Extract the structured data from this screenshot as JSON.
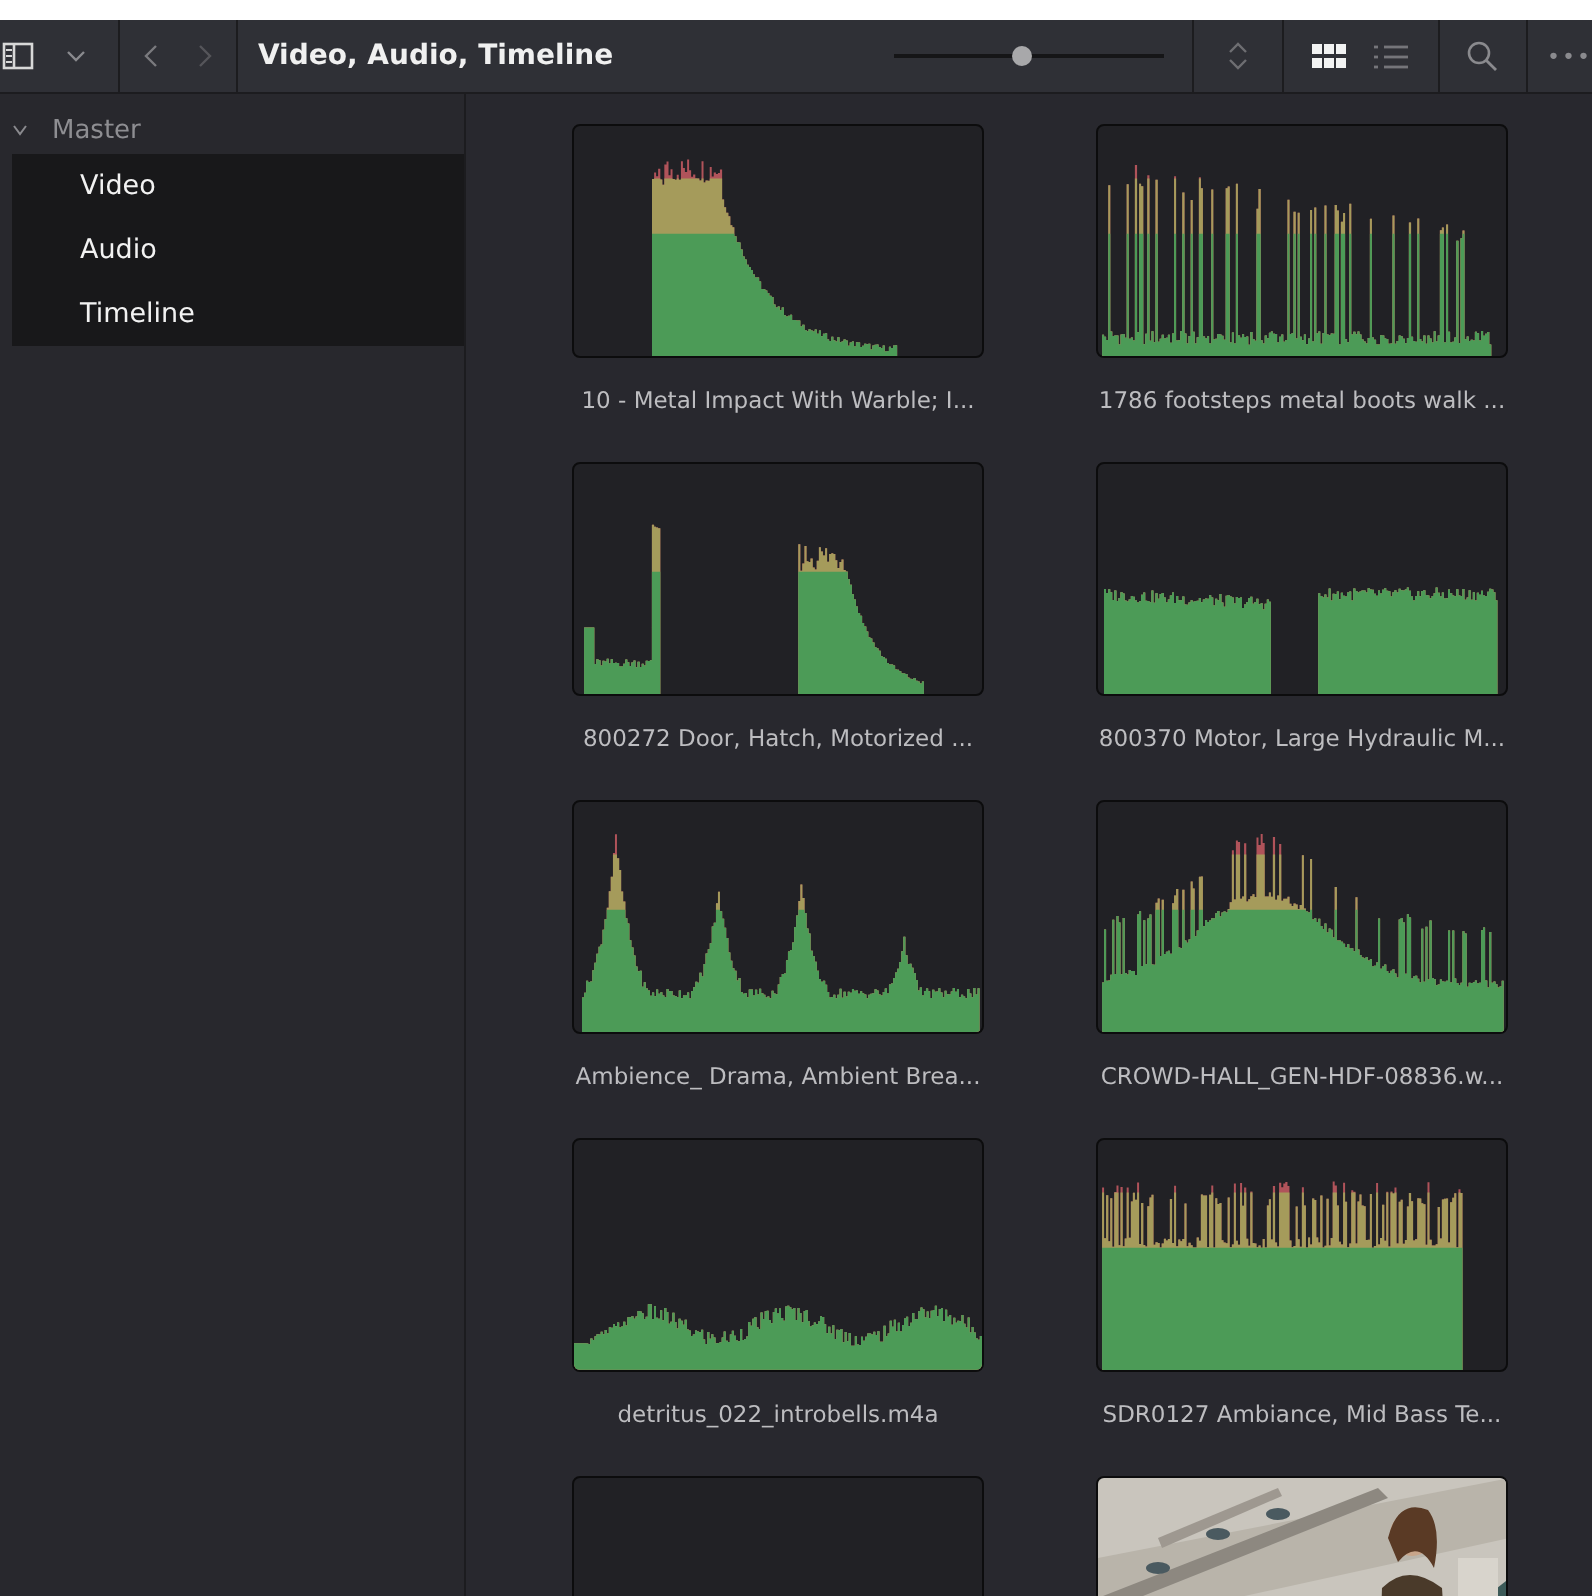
{
  "toolbar": {
    "title": "Video, Audio, Timeline",
    "zoom": {
      "level": 0.48
    },
    "views": [
      {
        "kind": "grid",
        "selected": true
      },
      {
        "kind": "list",
        "selected": false
      }
    ],
    "more": "•••"
  },
  "sidebar": {
    "root": {
      "label": "Master",
      "expanded": true,
      "children": [
        {
          "label": "Video"
        },
        {
          "label": "Audio"
        },
        {
          "label": "Timeline"
        }
      ]
    }
  },
  "clips": [
    {
      "kind": "waveform",
      "name": "10 - Metal Impact With Warble; I..."
    },
    {
      "kind": "waveform",
      "name": "1786 footsteps metal boots walk ..."
    },
    {
      "kind": "waveform",
      "name": "800272 Door, Hatch, Motorized ..."
    },
    {
      "kind": "waveform",
      "name": "800370 Motor, Large Hydraulic M..."
    },
    {
      "kind": "waveform",
      "name": "Ambience_ Drama, Ambient Brea..."
    },
    {
      "kind": "waveform",
      "name": "CROWD-HALL_GEN-HDF-08836.w..."
    },
    {
      "kind": "waveform",
      "name": "detritus_022_introbells.m4a"
    },
    {
      "kind": "waveform",
      "name": "SDR0127 Ambiance, Mid Bass Te..."
    },
    {
      "kind": "empty"
    },
    {
      "kind": "picture"
    }
  ]
}
